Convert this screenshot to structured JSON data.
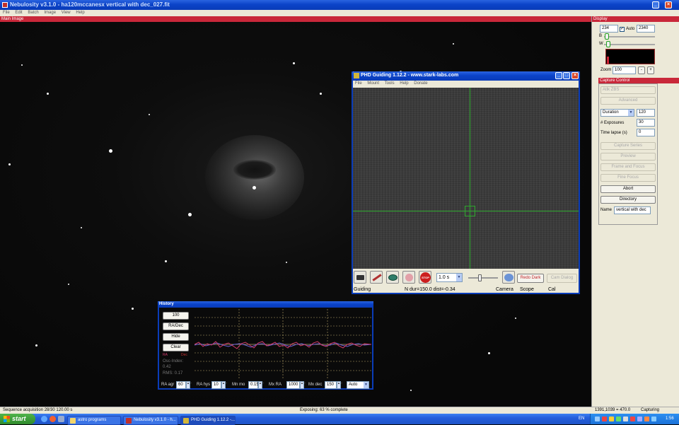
{
  "main_window": {
    "title": "Nebulosity v3.1.0 - ha120mccanesx vertical with dec_027.fit",
    "menu": [
      "File",
      "Edit",
      "Batch",
      "Image",
      "View",
      "Help"
    ],
    "image_label": "Main Image"
  },
  "display": {
    "header": "Display",
    "black_value": "234",
    "white_value": "2340",
    "auto_label": "Auto",
    "b_label": "B",
    "w_label": "W",
    "zoom_label": "Zoom",
    "zoom_value": "100",
    "zoom_minus": "-",
    "zoom_plus": "+"
  },
  "capture": {
    "header": "Capture Control",
    "camera": "Atlk ZBS",
    "advanced": "Advanced",
    "duration_label": "Duration",
    "duration_value": "120",
    "exposures_label": "# Exposures",
    "exposures_value": "30",
    "timelapse_label": "Time lapse (s)",
    "timelapse_value": "0",
    "capture_series": "Capture Series",
    "preview": "Preview",
    "frame_focus": "Frame and Focus",
    "fine_focus": "Fine Focus",
    "abort": "Abort",
    "directory": "Directory",
    "name_label": "Name",
    "name_value": "vertical with dec"
  },
  "phd": {
    "title": "PHD Guiding 1.12.2  -  www.stark-labs.com",
    "menu": [
      "File",
      "Mount",
      "Tools",
      "Help",
      "Donate"
    ],
    "exposure": "1.0 s",
    "redo_dark": "Redo Dark",
    "cam_dialog": "Cam Dialog",
    "status": "Guiding",
    "info": "N dur=150.0 dist=-0.34",
    "cam_label": "Camera",
    "scope_label": "Scope",
    "cal_label": "Cal",
    "stop_label": "STOP"
  },
  "history": {
    "title": "History",
    "scale_btn": "100",
    "mode_btn": "RA/Dec",
    "hide_btn": "Hide",
    "clear_btn": "Clear",
    "ra_label": "RA",
    "dec_label": "Dec",
    "osc_label": "Osc-Index:",
    "osc_value": "0.42",
    "rms_label": "RMS: 0.17",
    "controls": [
      {
        "label": "RA agr",
        "value": "60"
      },
      {
        "label": "RA hys",
        "value": "10"
      },
      {
        "label": "Mn mo",
        "value": "0.15"
      },
      {
        "label": "Mx RA",
        "value": "1000"
      },
      {
        "label": "Mx dec",
        "value": "150"
      }
    ],
    "auto_option": "Auto",
    "colors": {
      "ra": "#d23a6a",
      "dec": "#6a5fd6",
      "grid": "#b8a66a"
    }
  },
  "statusbar": {
    "left": "Sequence acquisition 28/30  120.00 s",
    "center": "Exposing: 63 % complete",
    "coords": "1391,1039 = 470.0",
    "state": "Capturing"
  },
  "taskbar": {
    "start": "start",
    "tasks": [
      "astro programs",
      "Nebulosity v3.1.0 - h...",
      "PHD Guiding 1.12.2 -..."
    ],
    "lang": "EN",
    "time": "1:56"
  }
}
